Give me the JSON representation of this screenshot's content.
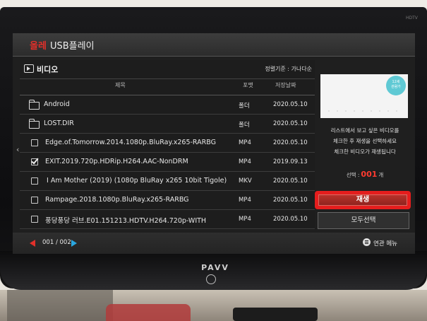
{
  "header": {
    "brand": "올레",
    "title": "USB플레이"
  },
  "section": {
    "title": "비디오",
    "sort_label": "정렬기준 : 가나다순"
  },
  "columns": {
    "name": "제목",
    "format": "포맷",
    "date": "저장날짜"
  },
  "rows": [
    {
      "kind": "folder",
      "name": "Android",
      "format": "폴더",
      "date": "2020.05.10",
      "checked": false
    },
    {
      "kind": "folder",
      "name": "LOST.DIR",
      "format": "폴더",
      "date": "2020.05.10",
      "checked": false
    },
    {
      "kind": "file",
      "name": "Edge.of.Tomorrow.2014.1080p.BluRay.x265-RARBG",
      "format": "MP4",
      "date": "2020.05.10",
      "checked": false
    },
    {
      "kind": "file",
      "name": "EXIT.2019.720p.HDRip.H264.AAC-NonDRM",
      "format": "MP4",
      "date": "2019.09.13",
      "checked": true
    },
    {
      "kind": "file",
      "name": "I Am Mother (2019) (1080p BluRay x265 10bit Tigole)",
      "format": "MKV",
      "date": "2020.05.10",
      "checked": false
    },
    {
      "kind": "file",
      "name": "Rampage.2018.1080p.BluRay.x265-RARBG",
      "format": "MP4",
      "date": "2020.05.10",
      "checked": false
    },
    {
      "kind": "file",
      "name": "풍당풍당 러브.E01.151213.HDTV.H264.720p-WITH",
      "format": "MP4",
      "date": "2020.05.10",
      "checked": false
    }
  ],
  "preview": {
    "badge_line1": "12세",
    "badge_line2": "관람가"
  },
  "instructions": {
    "line1": "리스트에서 보고 싶은 비디오를",
    "line2": "체크한 후 재생을 선택하세요",
    "line3": "체크한 비디오가 재생됩니다"
  },
  "selection": {
    "prefix": "선택 :",
    "count": "001",
    "suffix": "개"
  },
  "buttons": {
    "play": "재생",
    "select_all": "모두선택"
  },
  "pagination": {
    "current": "001",
    "separator": "/",
    "total": "002"
  },
  "footer": {
    "related_menu": "연관 메뉴"
  },
  "tv": {
    "brand": "PAVV",
    "badge": "HDTV"
  }
}
